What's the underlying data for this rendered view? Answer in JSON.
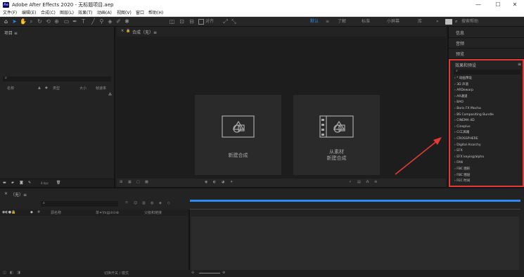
{
  "window": {
    "title": "Adobe After Effects 2020 - 无标题项目.aep",
    "app_icon": "Ae",
    "controls": {
      "minimize": "—",
      "maximize": "☐",
      "close": "✕"
    }
  },
  "menu": [
    "文件(F)",
    "编辑(E)",
    "合成(C)",
    "图层(L)",
    "效果(T)",
    "动画(A)",
    "视图(V)",
    "窗口",
    "帮助(H)"
  ],
  "toolbar": {
    "align_label": "对齐",
    "workspaces": [
      "默认",
      "≡",
      "了解",
      "标准",
      "小屏幕",
      "库"
    ],
    "search_placeholder": "搜索帮助",
    "overflow": "»"
  },
  "project_panel": {
    "title": "项目 ≡",
    "search_icon": "⌕",
    "columns": {
      "name": "名称",
      "type": "类型",
      "size": "大小",
      "rate": "帧速率"
    },
    "footer_bpc": "8 bpc"
  },
  "comp_panel": {
    "tab_label": "合成（无）≡",
    "cards": [
      {
        "line1": "新建合成",
        "line2": ""
      },
      {
        "line1": "从素材",
        "line2": "新建合成"
      }
    ]
  },
  "right_panel": {
    "sections": [
      "信息",
      "音频",
      "预览"
    ],
    "effects_title": "效果和预设",
    "effects_menu": "≡",
    "effects_search": "⌕",
    "effects": [
      "* 动画预设",
      "3D 声道",
      "ARDewarp",
      "AR通道",
      "BAO",
      "Boris FX Mocha",
      "BS Compositing Bundle",
      "CINEMA 4D",
      "Cineplus",
      "CI工具箱",
      "CROSSPHERE",
      "Digital Anarchy",
      "EFX",
      "EFX keying/alpha",
      "FAN",
      "FBC 图形",
      "FBC 图层",
      "FEC 时间"
    ]
  },
  "timeline": {
    "tab_label": "（无）≡",
    "search_icon": "⌕",
    "columns": {
      "source": "源名称",
      "switches": "单✦\\fx▤⊘⊙⊕",
      "parent": "父级和链接"
    },
    "footer": "切换开关 / 模式"
  },
  "accent": {
    "red": "#e53935",
    "blue": "#2a8cf0"
  }
}
